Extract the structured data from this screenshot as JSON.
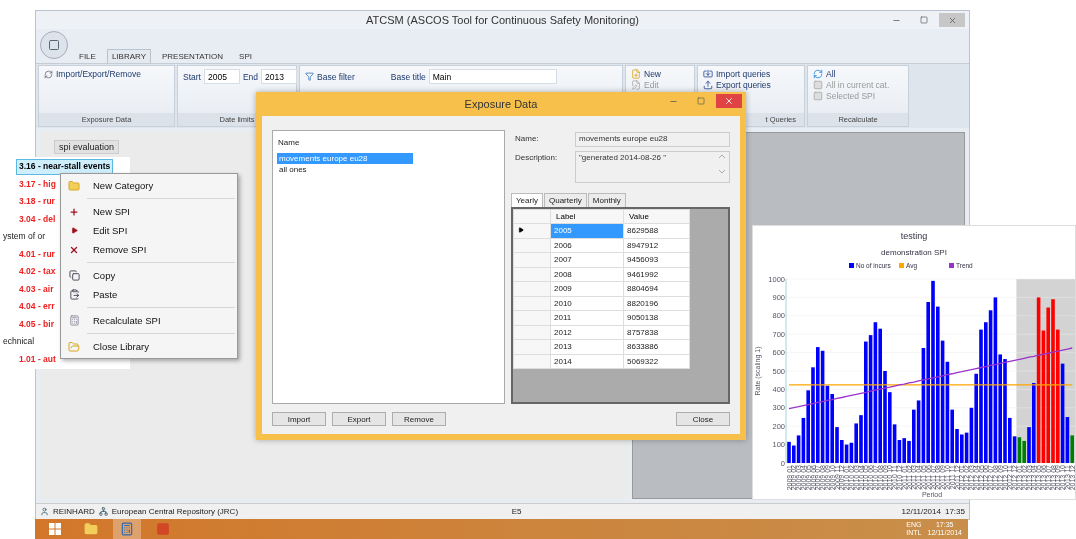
{
  "window": {
    "title": "ATCSM (ASCOS Tool for Continuous Safety Monitoring)"
  },
  "ribbon_tabs": [
    {
      "label": "FILE",
      "selected": false
    },
    {
      "label": "LIBRARY",
      "selected": true
    },
    {
      "label": "PRESENTATION",
      "selected": false
    },
    {
      "label": "SPI",
      "selected": false
    }
  ],
  "ribbon": {
    "exposure": {
      "button": "Import/Export/Remove",
      "label": "Exposure Data"
    },
    "dates": {
      "start_label": "Start",
      "start": "2005",
      "end_label": "End",
      "end": "2013",
      "label": "Date limits"
    },
    "filter": {
      "button": "Base filter",
      "title_label": "Base title",
      "title": "Main"
    },
    "library": {
      "items": [
        {
          "label": "New",
          "disabled": false
        },
        {
          "label": "Edit",
          "disabled": true
        }
      ]
    },
    "queries": {
      "items": [
        {
          "label": "Import queries",
          "disabled": false
        },
        {
          "label": "Export queries",
          "disabled": false
        }
      ],
      "label": "t Queries"
    },
    "recalculate": {
      "items": [
        {
          "label": "All",
          "disabled": false
        },
        {
          "label": "All in current cat.",
          "disabled": true
        },
        {
          "label": "Selected SPI",
          "disabled": true
        }
      ],
      "label": "Recalculate"
    }
  },
  "content_tab": "spi evaluation",
  "tree": [
    {
      "label": "3.16 - near-stall events",
      "selected": true
    },
    {
      "label": "3.17 - hig",
      "selected": false
    },
    {
      "label": "3.18 - rur",
      "selected": false
    },
    {
      "label": "3.04 - del",
      "selected": false
    },
    {
      "label": "ystem of or",
      "selected": false,
      "children": [
        {
          "label": "4.01 - rur",
          "selected": false
        },
        {
          "label": "4.02 - tax",
          "selected": false
        },
        {
          "label": "4.03 - air",
          "selected": false
        },
        {
          "label": "4.04 - err",
          "selected": false
        },
        {
          "label": "4.05 - bir",
          "selected": false
        }
      ]
    },
    {
      "label": "echnical",
      "selected": false,
      "children": [
        {
          "label": "1.01 - aut",
          "selected": false
        }
      ]
    }
  ],
  "context_menu": [
    [
      "New Category"
    ],
    [
      "New SPI",
      "Edit SPI",
      "Remove SPI"
    ],
    [
      "Copy",
      "Paste"
    ],
    [
      "Recalculate SPI"
    ],
    [
      "Close Library"
    ]
  ],
  "dialog": {
    "title": "Exposure Data",
    "list_header": "Name",
    "list": [
      {
        "label": "movements europe eu28",
        "selected": true
      },
      {
        "label": "all ones",
        "selected": false
      }
    ],
    "name_label": "Name:",
    "name": "movements europe eu28",
    "description_label": "Description:",
    "description": "\"generated 2014-08-26 \"",
    "tabs": [
      {
        "label": "Yearly",
        "selected": true
      },
      {
        "label": "Quarterly",
        "selected": false
      },
      {
        "label": "Monthly",
        "selected": false
      }
    ],
    "columns": [
      "Label",
      "Value"
    ],
    "rows": [
      {
        "cells": [
          "2005",
          "8629588"
        ],
        "selected": true
      },
      {
        "cells": [
          "2006",
          "8947912"
        ],
        "selected": false
      },
      {
        "cells": [
          "2007",
          "9456093"
        ],
        "selected": false
      },
      {
        "cells": [
          "2008",
          "9461992"
        ],
        "selected": false
      },
      {
        "cells": [
          "2009",
          "8804694"
        ],
        "selected": false
      },
      {
        "cells": [
          "2010",
          "8820196"
        ],
        "selected": false
      },
      {
        "cells": [
          "2011",
          "9050138"
        ],
        "selected": false
      },
      {
        "cells": [
          "2012",
          "8757838"
        ],
        "selected": false
      },
      {
        "cells": [
          "2013",
          "8633886"
        ],
        "selected": false
      },
      {
        "cells": [
          "2014",
          "5069322"
        ],
        "selected": false
      }
    ],
    "buttons": [
      "Import",
      "Export",
      "Remove"
    ],
    "close_button": "Close"
  },
  "chart_card": {
    "title": "testing",
    "subtitle": "demonstration SPI",
    "chart_data": {
      "type": "bar",
      "xlabel": "Period",
      "ylabel": "Rate (scaling 1)",
      "ylim": [
        0,
        1000
      ],
      "yticks": [
        0,
        100,
        200,
        300,
        400,
        500,
        600,
        700,
        800,
        900,
        1000
      ],
      "categories": [
        "2009 01",
        "2009 02",
        "2009 03",
        "2009 04",
        "2009 05",
        "2009 06",
        "2009 07",
        "2009 08",
        "2009 09",
        "2009 10",
        "2009 11",
        "2009 12",
        "2010 01",
        "2010 02",
        "2010 03",
        "2010 04",
        "2010 05",
        "2010 06",
        "2010 07",
        "2010 08",
        "2010 09",
        "2010 10",
        "2010 11",
        "2010 12",
        "2011 01",
        "2011 02",
        "2011 03",
        "2011 04",
        "2011 05",
        "2011 06",
        "2011 07",
        "2011 08",
        "2011 09",
        "2011 10",
        "2011 11",
        "2011 12",
        "2012 01",
        "2012 02",
        "2012 03",
        "2012 04",
        "2012 05",
        "2012 06",
        "2012 07",
        "2012 08",
        "2012 09",
        "2012 10",
        "2012 11",
        "2012 12",
        "2013 01",
        "2013 02",
        "2013 03",
        "2013 04",
        "2013 05",
        "2013 06",
        "2013 07",
        "2013 08",
        "2013 09",
        "2013 10",
        "2013 11",
        "2013 12"
      ],
      "series": [
        {
          "name": "No of incurs",
          "color": "#0000ff",
          "values": [
            115,
            95,
            150,
            245,
            395,
            520,
            630,
            610,
            420,
            375,
            195,
            125,
            100,
            110,
            215,
            260,
            660,
            695,
            765,
            730,
            500,
            385,
            210,
            125,
            135,
            120,
            290,
            340,
            625,
            875,
            990,
            850,
            665,
            550,
            290,
            185,
            155,
            165,
            300,
            485,
            725,
            765,
            830,
            900,
            590,
            565,
            245,
            145,
            null,
            null,
            195,
            435,
            null,
            null,
            null,
            null,
            null,
            540,
            250,
            null
          ]
        },
        {
          "color": "#008000",
          "values": [
            null,
            null,
            null,
            null,
            null,
            null,
            null,
            null,
            null,
            null,
            null,
            null,
            null,
            null,
            null,
            null,
            null,
            null,
            null,
            null,
            null,
            null,
            null,
            null,
            null,
            null,
            null,
            null,
            null,
            null,
            null,
            null,
            null,
            null,
            null,
            null,
            null,
            null,
            null,
            null,
            null,
            null,
            null,
            null,
            null,
            null,
            null,
            null,
            140,
            120,
            null,
            null,
            null,
            null,
            null,
            null,
            null,
            null,
            null,
            150
          ]
        },
        {
          "color": "#ff0000",
          "values": [
            null,
            null,
            null,
            null,
            null,
            null,
            null,
            null,
            null,
            null,
            null,
            null,
            null,
            null,
            null,
            null,
            null,
            null,
            null,
            null,
            null,
            null,
            null,
            null,
            null,
            null,
            null,
            null,
            null,
            null,
            null,
            null,
            null,
            null,
            null,
            null,
            null,
            null,
            null,
            null,
            null,
            null,
            null,
            null,
            null,
            null,
            null,
            null,
            null,
            null,
            null,
            null,
            900,
            720,
            845,
            890,
            725,
            null,
            null,
            null
          ]
        },
        {
          "name": "Avg",
          "color": "#ffa500",
          "type": "line",
          "values": [
            425,
            425,
            425,
            425,
            425,
            425,
            425,
            425,
            425,
            425,
            425,
            425,
            425,
            425,
            425,
            425,
            425,
            425,
            425,
            425,
            425,
            425,
            425,
            425,
            425,
            425,
            425,
            425,
            425,
            425,
            425,
            425,
            425,
            425,
            425,
            425,
            425,
            425,
            425,
            425,
            425,
            425,
            425,
            425,
            425,
            425,
            425,
            425,
            425,
            425,
            425,
            425,
            425,
            425,
            425,
            425,
            425,
            425,
            425,
            425
          ]
        },
        {
          "name": "Trend",
          "color": "#9932cc",
          "type": "line",
          "values": [
            295,
            301,
            306,
            312,
            317,
            323,
            329,
            334,
            340,
            345,
            351,
            356,
            362,
            368,
            373,
            379,
            384,
            390,
            396,
            401,
            407,
            412,
            418,
            424,
            429,
            435,
            440,
            446,
            452,
            457,
            463,
            468,
            474,
            480,
            485,
            491,
            496,
            502,
            507,
            513,
            519,
            524,
            530,
            535,
            541,
            547,
            552,
            558,
            563,
            569,
            575,
            580,
            586,
            591,
            597,
            602,
            608,
            614,
            619,
            625
          ]
        }
      ],
      "stacked": true,
      "grid": true,
      "legend": true
    }
  },
  "status_bar": {
    "user": "REINHARD",
    "repository": "European Central Repository (JRC)",
    "code": "E5",
    "date": "12/11/2014",
    "time": "17:35"
  },
  "taskbar": {
    "language": "ENG",
    "layout": "INTL",
    "time": "17:35",
    "date": "12/11/2014"
  }
}
